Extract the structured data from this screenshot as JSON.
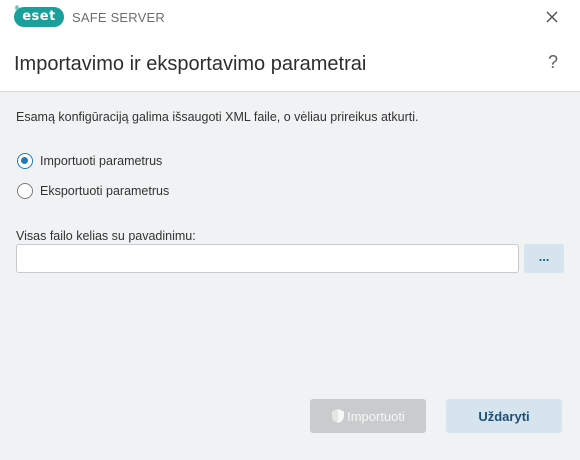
{
  "app": {
    "logo_text": "eset",
    "product": "SAFE SERVER",
    "brand_color": "#1a9f9a"
  },
  "window": {
    "close_icon": "close-icon"
  },
  "header": {
    "title": "Importavimo ir eksportavimo parametrai",
    "help_label": "?"
  },
  "main": {
    "description": "Esamą konfigūraciją galima išsaugoti XML faile, o vėliau prireikus atkurti.",
    "options": [
      {
        "label": "Importuoti parametrus",
        "selected": true
      },
      {
        "label": "Eksportuoti parametrus",
        "selected": false
      }
    ],
    "path_label": "Visas failo kelias su pavadinimu:",
    "path_value": "",
    "browse_label": "..."
  },
  "footer": {
    "import_label": "Importuoti",
    "import_enabled": false,
    "close_label": "Uždaryti"
  },
  "colors": {
    "accent": "#1f7ab8",
    "secondary_button": "#d6e4ee",
    "disabled_button": "#c9cbcd"
  }
}
